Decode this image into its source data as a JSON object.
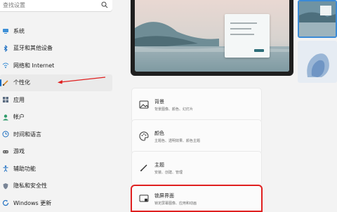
{
  "search": {
    "placeholder": "查找设置"
  },
  "sidebar": {
    "items": [
      {
        "label": "系统",
        "icon": "system-icon"
      },
      {
        "label": "蓝牙和其他设备",
        "icon": "bluetooth-icon"
      },
      {
        "label": "网络和 Internet",
        "icon": "network-icon"
      },
      {
        "label": "个性化",
        "icon": "personalization-brush-icon",
        "selected": true
      },
      {
        "label": "应用",
        "icon": "apps-icon"
      },
      {
        "label": "帐户",
        "icon": "account-icon"
      },
      {
        "label": "时间和语言",
        "icon": "time-language-icon"
      },
      {
        "label": "游戏",
        "icon": "gaming-icon"
      },
      {
        "label": "辅助功能",
        "icon": "accessibility-icon"
      },
      {
        "label": "隐私和安全性",
        "icon": "privacy-shield-icon"
      },
      {
        "label": "Windows 更新",
        "icon": "windows-update-icon"
      }
    ]
  },
  "cards": [
    {
      "title": "背景",
      "subtitle": "背景图像、颜色、幻灯片",
      "icon": "image-icon"
    },
    {
      "title": "颜色",
      "subtitle": "主题色、透明效果、颜色主题",
      "icon": "palette-icon"
    },
    {
      "title": "主题",
      "subtitle": "安装、创建、管理",
      "icon": "brush-icon"
    },
    {
      "title": "锁屏界面",
      "subtitle": "锁定屏幕图像、应用和动画",
      "icon": "lock-screen-icon",
      "highlighted": true
    }
  ],
  "colors": {
    "accent": "#0067c0",
    "annotation": "#e02020"
  }
}
